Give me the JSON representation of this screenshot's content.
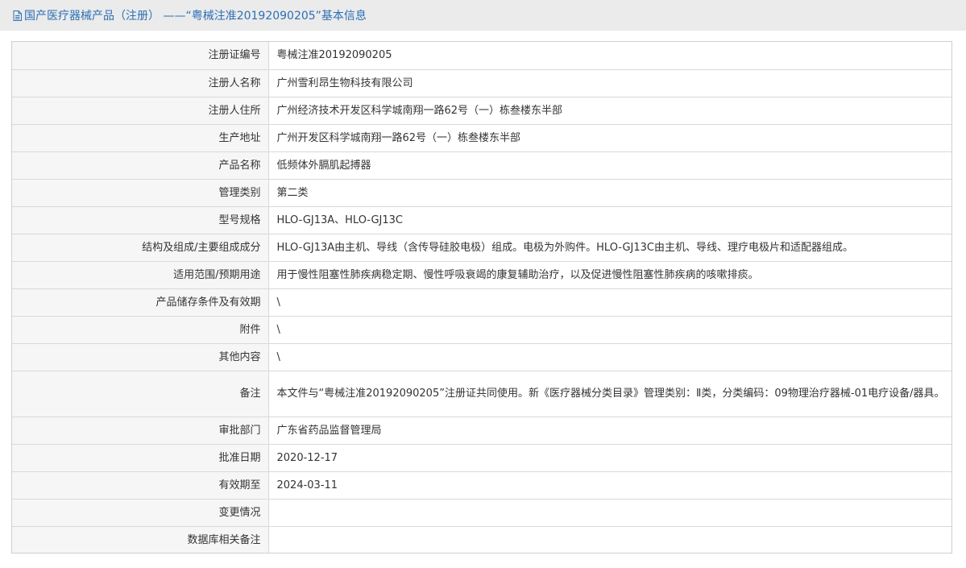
{
  "header": {
    "title": "国产医疗器械产品（注册） ——“粤械注准20192090205”基本信息",
    "icon": "document-icon",
    "accent_color": "#2c6fb4"
  },
  "rows": [
    {
      "label": "注册证编号",
      "value": "粤械注准20192090205"
    },
    {
      "label": "注册人名称",
      "value": "广州雪利昂生物科技有限公司"
    },
    {
      "label": "注册人住所",
      "value": "广州经济技术开发区科学城南翔一路62号（一）栋叁楼东半部"
    },
    {
      "label": "生产地址",
      "value": "广州开发区科学城南翔一路62号（一）栋叁楼东半部"
    },
    {
      "label": "产品名称",
      "value": "低频体外膈肌起搏器"
    },
    {
      "label": "管理类别",
      "value": "第二类"
    },
    {
      "label": "型号规格",
      "value": "HLO-GJ13A、HLO-GJ13C"
    },
    {
      "label": "结构及组成/主要组成成分",
      "value": "HLO-GJ13A由主机、导线（含传导硅胶电极）组成。电极为外购件。HLO-GJ13C由主机、导线、理疗电极片和适配器组成。"
    },
    {
      "label": "适用范围/预期用途",
      "value": "用于慢性阻塞性肺疾病稳定期、慢性呼吸衰竭的康复辅助治疗，以及促进慢性阻塞性肺疾病的咳嗽排痰。"
    },
    {
      "label": "产品储存条件及有效期",
      "value": "\\"
    },
    {
      "label": "附件",
      "value": "\\"
    },
    {
      "label": "其他内容",
      "value": "\\"
    },
    {
      "label": "备注",
      "value": "本文件与“粤械注准20192090205”注册证共同使用。新《医疗器械分类目录》管理类别：Ⅱ类，分类编码：09物理治疗器械-01电疗设备/器具。"
    },
    {
      "label": "审批部门",
      "value": "广东省药品监督管理局"
    },
    {
      "label": "批准日期",
      "value": "2020-12-17"
    },
    {
      "label": "有效期至",
      "value": "2024-03-11"
    },
    {
      "label": "变更情况",
      "value": ""
    },
    {
      "label": "数据库相关备注",
      "value": ""
    }
  ]
}
